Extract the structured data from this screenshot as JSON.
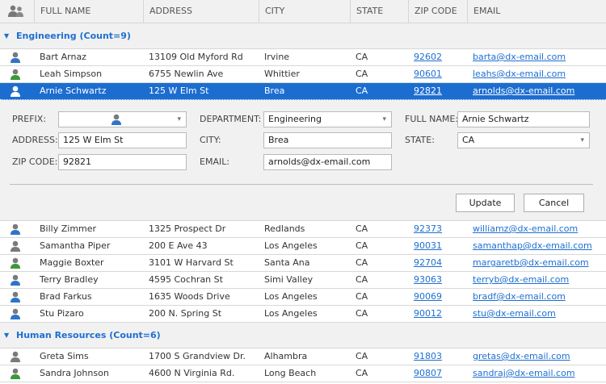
{
  "columns": [
    "FULL NAME",
    "ADDRESS",
    "CITY",
    "STATE",
    "ZIP CODE",
    "EMAIL"
  ],
  "groups": [
    {
      "label": "Engineering (Count=9)",
      "rows": [
        {
          "name": "Bart Arnaz",
          "address": "13109 Old Myford Rd",
          "city": "Irvine",
          "state": "CA",
          "zip": "92602",
          "email": "barta@dx-email.com",
          "icon": "male"
        },
        {
          "name": "Leah Simpson",
          "address": "6755 Newlin Ave",
          "city": "Whittier",
          "state": "CA",
          "zip": "90601",
          "email": "leahs@dx-email.com",
          "icon": "female"
        },
        {
          "name": "Arnie Schwartz",
          "address": "125 W Elm St",
          "city": "Brea",
          "state": "CA",
          "zip": "92821",
          "email": "arnolds@dx-email.com",
          "icon": "male",
          "selected": true
        },
        {
          "name": "Billy Zimmer",
          "address": "1325 Prospect Dr",
          "city": "Redlands",
          "state": "CA",
          "zip": "92373",
          "email": "williamz@dx-email.com",
          "icon": "male"
        },
        {
          "name": "Samantha Piper",
          "address": "200 E Ave 43",
          "city": "Los Angeles",
          "state": "CA",
          "zip": "90031",
          "email": "samanthap@dx-email.com",
          "icon": "none"
        },
        {
          "name": "Maggie Boxter",
          "address": "3101 W Harvard St",
          "city": "Santa Ana",
          "state": "CA",
          "zip": "92704",
          "email": "margaretb@dx-email.com",
          "icon": "female"
        },
        {
          "name": "Terry Bradley",
          "address": "4595 Cochran St",
          "city": "Simi Valley",
          "state": "CA",
          "zip": "93063",
          "email": "terryb@dx-email.com",
          "icon": "male"
        },
        {
          "name": "Brad Farkus",
          "address": "1635 Woods Drive",
          "city": "Los Angeles",
          "state": "CA",
          "zip": "90069",
          "email": "bradf@dx-email.com",
          "icon": "male"
        },
        {
          "name": "Stu Pizaro",
          "address": "200 N. Spring St",
          "city": "Los Angeles",
          "state": "CA",
          "zip": "90012",
          "email": "stu@dx-email.com",
          "icon": "male"
        }
      ]
    },
    {
      "label": "Human Resources (Count=6)",
      "rows": [
        {
          "name": "Greta Sims",
          "address": "1700 S Grandview Dr.",
          "city": "Alhambra",
          "state": "CA",
          "zip": "91803",
          "email": "gretas@dx-email.com",
          "icon": "none"
        },
        {
          "name": "Sandra Johnson",
          "address": "4600 N Virginia Rd.",
          "city": "Long Beach",
          "state": "CA",
          "zip": "90807",
          "email": "sandraj@dx-email.com",
          "icon": "female"
        }
      ]
    }
  ],
  "form": {
    "prefix_label": "PREFIX:",
    "department_label": "DEPARTMENT:",
    "department_value": "Engineering",
    "fullname_label": "FULL NAME:",
    "fullname_value": "Arnie Schwartz",
    "address_label": "ADDRESS:",
    "address_value": "125 W Elm St",
    "city_label": "CITY:",
    "city_value": "Brea",
    "state_label": "STATE:",
    "state_value": "CA",
    "zip_label": "ZIP CODE:",
    "zip_value": "92821",
    "email_label": "EMAIL:",
    "email_value": "arnolds@dx-email.com",
    "update": "Update",
    "cancel": "Cancel"
  },
  "colors": {
    "accent": "#1c6dd0",
    "male": "#2e75c8",
    "female": "#3a9a3a",
    "neutral": "#7a7a7a"
  }
}
